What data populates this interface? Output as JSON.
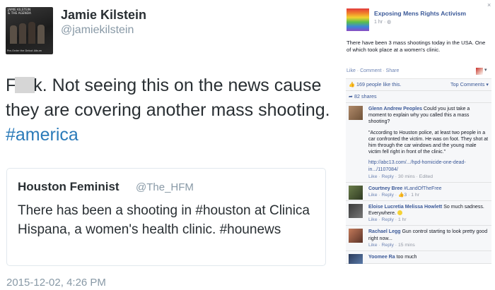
{
  "tweet": {
    "author_name": "Jamie Kilstein",
    "author_handle": "@jamiekilstein",
    "avatar_top_text": "JAMIE KILSTEIN\n& THE AGENDA",
    "avatar_bottom_text": "Pre-Order the Debut Album",
    "text_part1": "F",
    "text_part2": "k. Not seeing this on the news cause they are covering another mass shooting. ",
    "hashtag": "#america",
    "quote": {
      "name": "Houston Feminist",
      "handle": "@The_HFM",
      "text": "There has been a shooting in #houston at Clinica Hispana, a women's health clinic. #hounews"
    },
    "timestamp": "2015-12-02, 4:26 PM"
  },
  "facebook": {
    "page_name": "Exposing Mens Rights Activism",
    "post_meta": "1 hr · ",
    "close_glyph": "×",
    "post_text": "There have been 3 mass shootings today in the USA. One of which took place at a women's clinic.",
    "actions": {
      "like": "Like",
      "comment": "Comment",
      "share": "Share",
      "sep": " · "
    },
    "likes_text": "169 people like this.",
    "top_comments": "Top Comments",
    "shares_text": "82 shares",
    "comments": [
      {
        "author": "Glenn Andrew Peoples",
        "text": "Could you just take a moment to explain why you called this a mass shooting?",
        "quote": "\"According to Houston police, at least two people in a car confronted the victim. He was on foot. They shot at him through the car windows and the young male victim fell right in front of the clinic.\"",
        "link": "http://abc13.com/.../hpd-homicide-one-dead-in.../1107084/",
        "like": "Like",
        "reply": "Reply",
        "meta": " · 30 mins · Edited"
      },
      {
        "author": "Courtney Bree",
        "text": "#LandOfTheFree",
        "like": "Like",
        "reply": "Reply",
        "count": "3",
        "meta": " · 1 hr"
      },
      {
        "author": "Eloise Lucretia Melissa Howlett",
        "text": "So much sadness. Everywhere.",
        "like": "Like",
        "reply": "Reply",
        "meta": " · 1 hr"
      },
      {
        "author": "Rachael Legg",
        "text": "Gun control starting to look pretty good right now...",
        "like": "Like",
        "reply": "Reply",
        "meta": " · 15 mins"
      },
      {
        "author": "Yoomee Ra",
        "text": "too much"
      }
    ]
  }
}
